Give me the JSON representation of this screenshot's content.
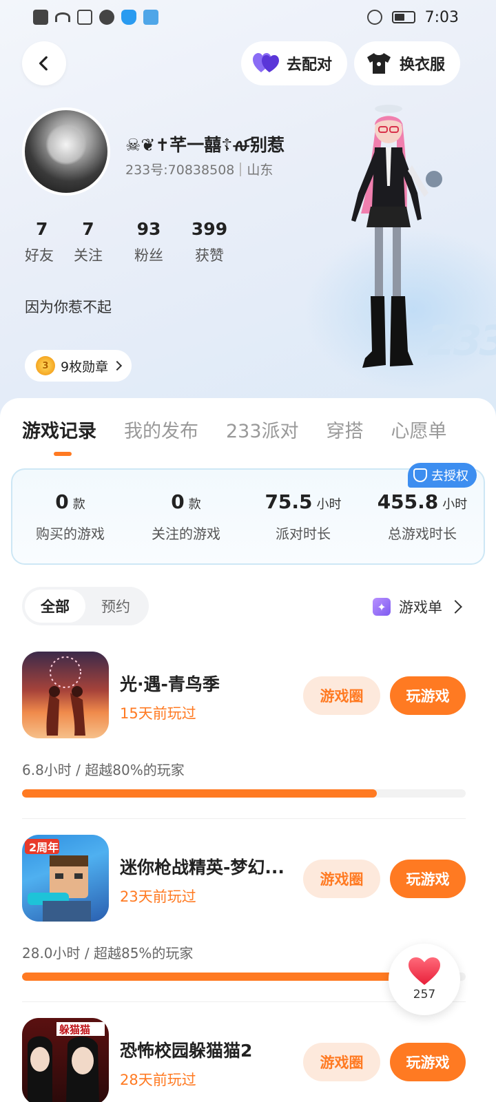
{
  "status_bar": {
    "time": "7:03"
  },
  "header": {
    "match_label": "去配对",
    "outfit_label": "换衣服"
  },
  "profile": {
    "nickname": "☠❦✝芊一囍☦ꫛ别惹",
    "id_text": "233号:70838508",
    "location": "山东",
    "stats": [
      {
        "num": "7",
        "label": "好友"
      },
      {
        "num": "7",
        "label": "关注"
      },
      {
        "num": "93",
        "label": "粉丝"
      },
      {
        "num": "399",
        "label": "获赞"
      }
    ],
    "bio": "因为你惹不起",
    "medal_text": "9枚勋章"
  },
  "tabs": [
    "游戏记录",
    "我的发布",
    "233派对",
    "穿搭",
    "心愿单"
  ],
  "summary": {
    "auth_label": "去授权",
    "items": [
      {
        "value": "0",
        "unit": "款",
        "label": "购买的游戏"
      },
      {
        "value": "0",
        "unit": "款",
        "label": "关注的游戏"
      },
      {
        "value": "75.5",
        "unit": "小时",
        "label": "派对时长"
      },
      {
        "value": "455.8",
        "unit": "小时",
        "label": "总游戏时长"
      }
    ]
  },
  "filter": {
    "options": [
      "全部",
      "预约"
    ],
    "selected": "全部",
    "game_list_label": "游戏单"
  },
  "games": [
    {
      "name": "光·遇-青鸟季",
      "played": "15天前玩过",
      "stat": "6.8小时 / 超越80%的玩家",
      "progress": 0.8,
      "circle_label": "游戏圈",
      "play_label": "玩游戏"
    },
    {
      "name": "迷你枪战精英-梦幻...",
      "played": "23天前玩过",
      "stat": "28.0小时 / 超越85%的玩家",
      "progress": 0.85,
      "circle_label": "游戏圈",
      "play_label": "玩游戏"
    },
    {
      "name": "恐怖校园躲猫猫2",
      "played": "28天前玩过",
      "stat": "",
      "progress": null,
      "circle_label": "游戏圈",
      "play_label": "玩游戏"
    }
  ],
  "like_fab": {
    "count": "257"
  },
  "icons": {
    "back": "chevron-left-icon",
    "match": "heart-pair-icon",
    "outfit": "tshirt-icon",
    "medal": "medal-icon",
    "auth": "shield-check-icon",
    "game_list": "sparkle-icon",
    "like": "heart-icon"
  },
  "colors": {
    "accent": "#ff7a22",
    "auth_blue": "#3d8ef0",
    "purple": "#7e5bf0"
  }
}
